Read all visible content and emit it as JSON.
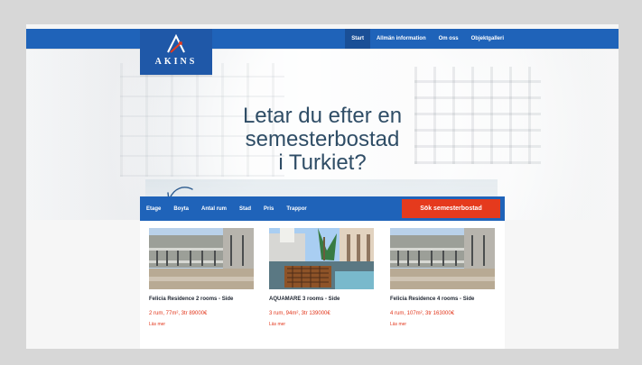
{
  "colors": {
    "brand_blue": "#1f63b9",
    "brand_blue_dark": "#1a4f96",
    "search_red": "#e53a1d",
    "price_red": "#e2361b",
    "headline_blue": "#2f4d66"
  },
  "logo": {
    "text": "AKINS",
    "icon": "akins-logo-icon"
  },
  "top_nav": [
    {
      "label": "Start"
    },
    {
      "label": "Allmän information"
    },
    {
      "label": "Om oss"
    },
    {
      "label": "Objektgalleri"
    }
  ],
  "hero": {
    "line1": "Letar du efter en",
    "line2": "semesterbostad",
    "line3": "i Turkiet?"
  },
  "search": {
    "filters": [
      {
        "label": "Etage"
      },
      {
        "label": "Boyta"
      },
      {
        "label": "Antal rum"
      },
      {
        "label": "Stad"
      },
      {
        "label": "Pris"
      },
      {
        "label": "Trappor"
      }
    ],
    "button": "Sök semesterbostad"
  },
  "cards": [
    {
      "title": "Felicia Residence 2 rooms - Side",
      "price": "2 rum, 77m², 3tr 89000€",
      "link": "Läs mer"
    },
    {
      "title": "AQUAMARE 3 rooms - Side",
      "price": "3 rum, 94m², 3tr 139000€",
      "link": "Läs mer"
    },
    {
      "title": "Felicia Residence 4 rooms - Side",
      "price": "4 rum, 107m², 3tr 163000€",
      "link": "Läs mer"
    }
  ]
}
